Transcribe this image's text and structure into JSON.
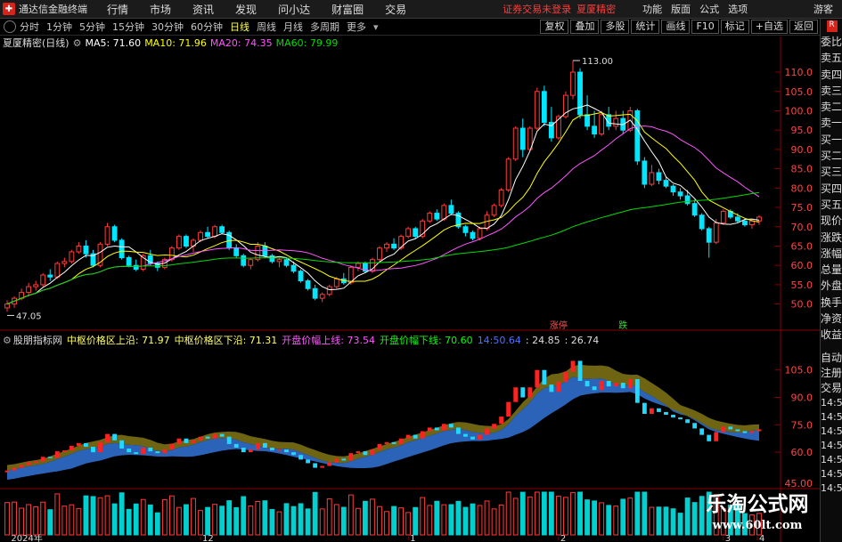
{
  "menubar": {
    "app_title": "通达信金融终端",
    "items": [
      "行情",
      "市场",
      "资讯",
      "发现",
      "问小达",
      "财富圈",
      "交易"
    ],
    "notice_left": "证券交易未登录",
    "notice_right": "夏厦精密",
    "right_items": [
      "功能",
      "版面",
      "公式",
      "选项"
    ],
    "guest": "游客"
  },
  "toolbar": {
    "periods": [
      "分时",
      "1分钟",
      "5分钟",
      "15分钟",
      "30分钟",
      "60分钟",
      "日线",
      "周线",
      "月线",
      "多周期",
      "更多"
    ],
    "active": "日线",
    "buttons": [
      "复权",
      "叠加",
      "多股",
      "统计",
      "画线",
      "F10",
      "标记",
      "+自选",
      "返回"
    ]
  },
  "sidebar": {
    "badge": "R",
    "items": [
      "委比",
      "卖五",
      "卖四",
      "卖三",
      "卖二",
      "卖一",
      "买一",
      "买二",
      "买三",
      "买四",
      "买五",
      "现价",
      "涨跌",
      "涨幅",
      "总量",
      "外盘",
      "换手",
      "净资",
      "收益"
    ],
    "lower_items": [
      "自动",
      "注册",
      "交易"
    ],
    "times": [
      "14:56",
      "14:56",
      "14:56",
      "14:56",
      "14:56",
      "14:56",
      "14:56"
    ]
  },
  "legend_main": {
    "stock": "夏厦精密(日线)",
    "ma5": "MA5: 71.60",
    "ma10": "MA10: 71.96",
    "ma20": "MA20: 74.35",
    "ma60": "MA60: 79.99",
    "colors": {
      "ma5": "#ffffff",
      "ma10": "#ffff00",
      "ma20": "#ff55ff",
      "ma60": "#00dd00"
    }
  },
  "legend_sub": {
    "name": "股朋指标网",
    "upper": "中枢价格区上沿: 71.97",
    "lower": "中枢价格区下沿: 71.31",
    "kaipan_upper": "开盘价幅上线: 73.54",
    "kaipan_lower": "开盘价幅下线: 70.60",
    "v5": "14:50.64",
    "v6": ": 24.85",
    "v7": ": 26.74"
  },
  "watermark": {
    "line1": "乐淘公式网",
    "line2": "www.60lt.com"
  },
  "chart_data": [
    {
      "type": "candlestick",
      "panel": "main",
      "ylim": [
        46,
        116
      ],
      "yticks": [
        50,
        55,
        60,
        65,
        70,
        75,
        80,
        85,
        90,
        95,
        100,
        105,
        110
      ],
      "annotations": [
        {
          "text": "113.00",
          "index": 79,
          "value": 113
        },
        {
          "text": "47.05",
          "index": 0,
          "value": 47.05
        }
      ],
      "markers": [
        {
          "text": "涨停",
          "index": 77
        },
        {
          "text": "跌",
          "index": 86
        }
      ],
      "ohlc": [
        [
          49,
          51,
          48,
          50
        ],
        [
          50,
          52,
          49,
          51.5
        ],
        [
          51.5,
          54,
          51,
          53
        ],
        [
          53,
          55.5,
          52,
          54.5
        ],
        [
          54.5,
          56,
          53.5,
          55
        ],
        [
          55,
          58,
          54.5,
          57.5
        ],
        [
          57.5,
          59,
          56,
          57
        ],
        [
          57,
          61,
          56.5,
          60.5
        ],
        [
          60.5,
          62,
          59.5,
          61
        ],
        [
          61,
          64,
          60.5,
          63.5
        ],
        [
          63.5,
          66,
          63,
          65
        ],
        [
          65,
          66.5,
          62,
          63
        ],
        [
          63,
          64,
          59.5,
          60
        ],
        [
          60,
          66,
          59.5,
          65.5
        ],
        [
          65.5,
          71,
          65,
          70
        ],
        [
          70,
          70.5,
          66,
          66.5
        ],
        [
          66.5,
          67,
          61.5,
          62
        ],
        [
          62,
          62.5,
          59.5,
          60
        ],
        [
          60,
          61.5,
          58.5,
          59
        ],
        [
          59,
          63,
          58.5,
          62.5
        ],
        [
          62.5,
          64,
          60,
          60.5
        ],
        [
          60.5,
          61,
          58.5,
          59.5
        ],
        [
          59.5,
          62,
          59,
          61.5
        ],
        [
          61.5,
          65,
          61,
          64.5
        ],
        [
          64.5,
          68,
          64,
          67.5
        ],
        [
          67.5,
          68,
          64.5,
          65
        ],
        [
          65,
          67,
          63.5,
          66.5
        ],
        [
          66.5,
          69,
          66,
          68.5
        ],
        [
          68.5,
          70,
          67,
          67.5
        ],
        [
          67.5,
          70.5,
          67,
          70
        ],
        [
          70,
          70.5,
          68,
          68.5
        ],
        [
          68.5,
          69,
          64,
          64.5
        ],
        [
          64.5,
          65.5,
          62,
          62.5
        ],
        [
          62.5,
          63,
          59.5,
          60
        ],
        [
          60,
          62,
          59,
          61.5
        ],
        [
          61.5,
          66,
          61,
          65
        ],
        [
          65,
          66,
          62,
          62.5
        ],
        [
          62.5,
          63,
          60.5,
          61
        ],
        [
          61,
          62,
          59.5,
          61.5
        ],
        [
          61.5,
          62,
          59.5,
          60
        ],
        [
          60,
          61,
          58,
          58.5
        ],
        [
          58.5,
          59,
          55.5,
          56
        ],
        [
          56,
          56.5,
          53.5,
          54
        ],
        [
          54,
          55,
          51,
          51.5
        ],
        [
          51.5,
          53,
          50.5,
          52.5
        ],
        [
          52.5,
          55,
          52,
          54.5
        ],
        [
          54.5,
          57,
          54,
          56.5
        ],
        [
          56.5,
          58,
          55,
          55.5
        ],
        [
          55.5,
          60,
          55,
          59.5
        ],
        [
          59.5,
          61,
          58.5,
          60.5
        ],
        [
          60.5,
          61,
          58,
          58.5
        ],
        [
          58.5,
          62,
          58,
          61.5
        ],
        [
          61.5,
          65,
          61,
          64.5
        ],
        [
          64.5,
          66,
          63.5,
          65.5
        ],
        [
          65.5,
          67,
          64,
          64.5
        ],
        [
          64.5,
          68,
          64,
          67.5
        ],
        [
          67.5,
          70,
          67,
          69.5
        ],
        [
          69.5,
          70,
          67,
          67.5
        ],
        [
          67.5,
          72,
          67,
          71.5
        ],
        [
          71.5,
          74,
          71,
          73.5
        ],
        [
          73.5,
          74.5,
          71.5,
          72
        ],
        [
          72,
          76,
          71.5,
          75.5
        ],
        [
          75.5,
          77,
          73,
          73.5
        ],
        [
          73.5,
          74,
          69.5,
          70
        ],
        [
          70,
          70.5,
          67.5,
          68.5
        ],
        [
          68.5,
          69,
          66.5,
          67
        ],
        [
          67,
          70,
          66.5,
          69.5
        ],
        [
          69.5,
          74,
          69,
          73
        ],
        [
          73,
          76,
          72.5,
          75.5
        ],
        [
          75.5,
          80,
          75,
          79.5
        ],
        [
          79.5,
          88,
          79,
          87.5
        ],
        [
          87.5,
          96,
          87,
          95.5
        ],
        [
          95.5,
          98,
          88,
          90
        ],
        [
          90,
          96,
          89.5,
          95.5
        ],
        [
          95.5,
          106,
          95,
          105
        ],
        [
          105,
          106.5,
          96,
          97
        ],
        [
          97,
          101,
          92,
          93
        ],
        [
          93,
          99,
          92.5,
          98.5
        ],
        [
          98.5,
          105,
          98,
          104
        ],
        [
          104,
          113,
          103,
          110
        ],
        [
          110,
          111,
          98,
          99
        ],
        [
          99,
          104,
          95,
          96
        ],
        [
          96,
          100,
          93,
          94
        ],
        [
          94,
          100,
          93.5,
          99
        ],
        [
          99,
          101,
          95,
          96
        ],
        [
          96,
          100,
          95,
          98
        ],
        [
          98,
          100,
          94,
          95
        ],
        [
          95,
          101,
          94.5,
          100
        ],
        [
          100,
          100.5,
          86,
          87
        ],
        [
          87,
          88,
          80,
          81
        ],
        [
          81,
          86,
          80.5,
          84
        ],
        [
          84,
          85,
          81,
          82
        ],
        [
          82,
          83,
          80,
          80.5
        ],
        [
          80.5,
          81,
          78,
          79
        ],
        [
          79,
          80,
          77,
          78
        ],
        [
          78,
          79.5,
          75.5,
          76
        ],
        [
          76,
          77,
          72.5,
          73
        ],
        [
          73,
          73.5,
          69,
          69.5
        ],
        [
          69.5,
          70,
          62,
          66
        ],
        [
          66,
          72,
          65.5,
          71
        ],
        [
          71,
          74.5,
          70.5,
          74
        ],
        [
          74,
          74.5,
          72,
          72.5
        ],
        [
          72.5,
          73.5,
          71,
          71.5
        ],
        [
          71.5,
          72,
          70,
          70.5
        ],
        [
          70.5,
          72,
          69.5,
          71.5
        ],
        [
          71.5,
          73,
          70.5,
          72.5
        ]
      ],
      "ma": {
        "ma5": 71.6,
        "ma10": 71.96,
        "ma20": 74.35,
        "ma60": 79.99
      }
    },
    {
      "type": "area",
      "panel": "indicator",
      "ylim": [
        44,
        118
      ],
      "yticks": [
        60,
        75,
        90,
        105
      ],
      "bottom_label": "45.00"
    },
    {
      "type": "bar",
      "panel": "volume",
      "xticks": [
        {
          "text": "2024年",
          "index": 3
        },
        {
          "text": "12",
          "index": 27
        },
        {
          "text": "1",
          "index": 56
        },
        {
          "text": "2",
          "index": 77
        },
        {
          "text": "3",
          "index": 100
        },
        {
          "text": "4",
          "index": 127
        }
      ]
    }
  ]
}
